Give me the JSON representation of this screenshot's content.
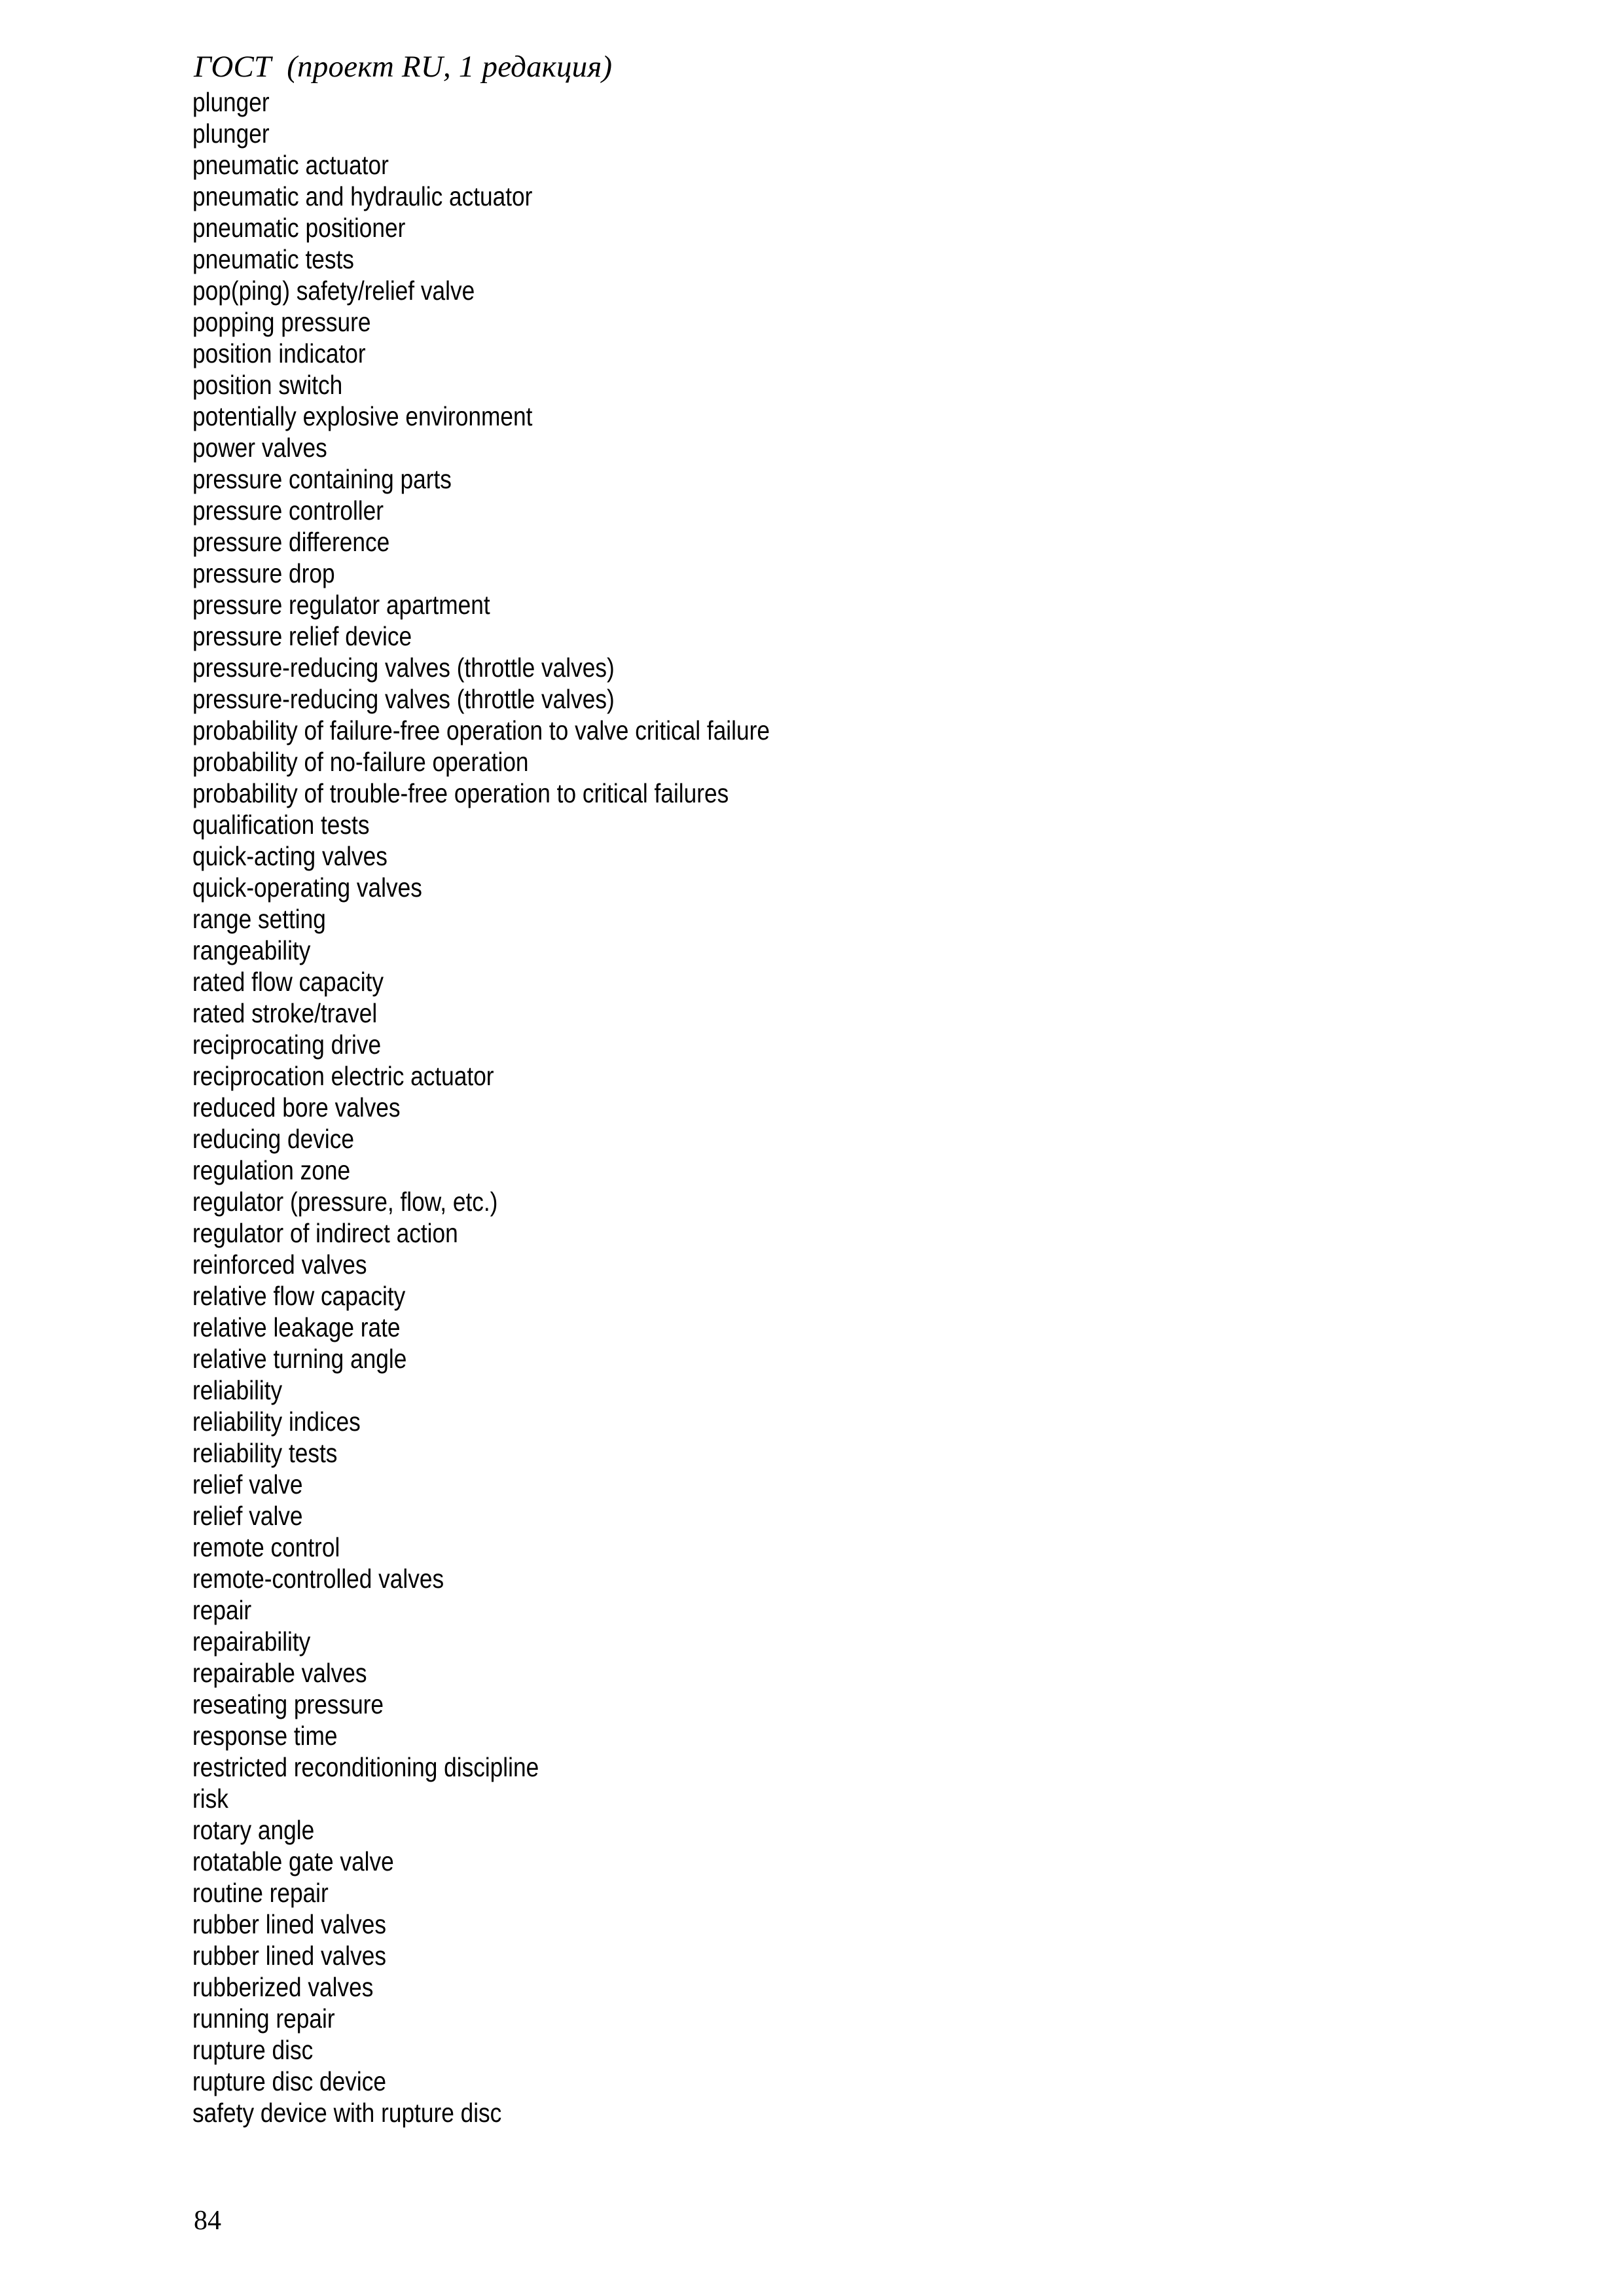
{
  "document": {
    "header": "ГОСТ  (проект RU, 1 редакция)",
    "page_number": "84"
  },
  "terms": [
    "plunger",
    "plunger",
    "pneumatic actuator",
    "pneumatic and hydraulic actuator",
    "pneumatic positioner",
    "pneumatic tests",
    "pop(ping) safety/relief valve",
    "popping pressure",
    "position indicator",
    "position switch",
    "potentially explosive environment",
    "power valves",
    "pressure containing parts",
    "pressure controller",
    "pressure difference",
    "pressure drop",
    "pressure regulator apartment",
    "pressure relief device",
    "pressure-reducing valves (throttle valves)",
    "pressure-reducing valves (throttle valves)",
    "probability of failure-free operation to valve critical failure",
    "probability of no-failure operation",
    "probability of trouble-free operation to critical failures",
    "qualification tests",
    "quick-acting valves",
    "quick-operating valves",
    "range setting",
    "rangeability",
    "rated flow capacity",
    "rated stroke/travel",
    "reciprocating drive",
    "reciprocation electric actuator",
    "reduced bore valves",
    "reducing device",
    "regulation zone",
    "regulator (pressure, flow, etc.)",
    "regulator of indirect action",
    "reinforced valves",
    "relative flow capacity",
    "relative leakage rate",
    "relative turning angle",
    "reliability",
    "reliability indices",
    "reliability tests",
    "relief valve",
    "relief valve",
    "remote control",
    "remote-controlled valves",
    "repair",
    "repairability",
    "repairable valves",
    "reseating pressure",
    "response time",
    "restricted reconditioning discipline",
    "risk",
    "rotary angle",
    "rotatable gate valve",
    "routine repair",
    "rubber lined valves",
    "rubber lined valves",
    "rubberized valves",
    "running repair",
    "rupture disc",
    "rupture disc device",
    "safety device with rupture disc"
  ]
}
